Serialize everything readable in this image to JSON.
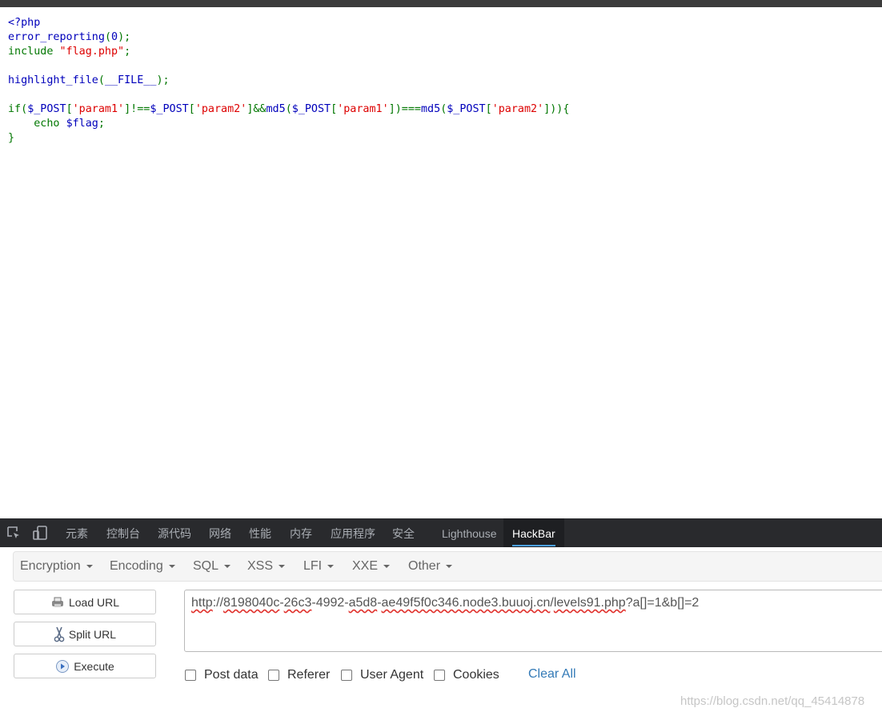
{
  "code": {
    "lines": [
      [
        {
          "t": "<?php",
          "c": "def"
        }
      ],
      [
        {
          "t": "error_reporting",
          "c": "def"
        },
        {
          "t": "(",
          "c": "kw"
        },
        {
          "t": "0",
          "c": "def"
        },
        {
          "t": ");",
          "c": "kw"
        }
      ],
      [
        {
          "t": "include ",
          "c": "kw"
        },
        {
          "t": "\"flag.php\"",
          "c": "str"
        },
        {
          "t": ";",
          "c": "kw"
        }
      ],
      [],
      [
        {
          "t": "highlight_file",
          "c": "def"
        },
        {
          "t": "(",
          "c": "kw"
        },
        {
          "t": "__FILE__",
          "c": "def"
        },
        {
          "t": ");",
          "c": "kw"
        }
      ],
      [],
      [
        {
          "t": "if(",
          "c": "kw"
        },
        {
          "t": "$_POST",
          "c": "def"
        },
        {
          "t": "[",
          "c": "kw"
        },
        {
          "t": "'param1'",
          "c": "str"
        },
        {
          "t": "]!==",
          "c": "kw"
        },
        {
          "t": "$_POST",
          "c": "def"
        },
        {
          "t": "[",
          "c": "kw"
        },
        {
          "t": "'param2'",
          "c": "str"
        },
        {
          "t": "]&&",
          "c": "kw"
        },
        {
          "t": "md5",
          "c": "def"
        },
        {
          "t": "(",
          "c": "kw"
        },
        {
          "t": "$_POST",
          "c": "def"
        },
        {
          "t": "[",
          "c": "kw"
        },
        {
          "t": "'param1'",
          "c": "str"
        },
        {
          "t": "])===",
          "c": "kw"
        },
        {
          "t": "md5",
          "c": "def"
        },
        {
          "t": "(",
          "c": "kw"
        },
        {
          "t": "$_POST",
          "c": "def"
        },
        {
          "t": "[",
          "c": "kw"
        },
        {
          "t": "'param2'",
          "c": "str"
        },
        {
          "t": "])){",
          "c": "kw"
        }
      ],
      [
        {
          "t": "    echo ",
          "c": "kw"
        },
        {
          "t": "$flag",
          "c": "def"
        },
        {
          "t": ";",
          "c": "kw"
        }
      ],
      [
        {
          "t": "}",
          "c": "kw"
        }
      ]
    ]
  },
  "devtools": {
    "tabs": [
      "元素",
      "控制台",
      "源代码",
      "网络",
      "性能",
      "内存",
      "应用程序",
      "安全",
      "Lighthouse"
    ],
    "active_tab": "HackBar",
    "icons": [
      "inspect-element-icon",
      "device-toolbar-icon"
    ]
  },
  "hackbar": {
    "menus": [
      "Encryption",
      "Encoding",
      "SQL",
      "XSS",
      "LFI",
      "XXE",
      "Other"
    ],
    "buttons": {
      "load": {
        "label": "Load URL",
        "icon": "load-url-icon"
      },
      "split": {
        "label": "Split URL",
        "icon": "scissors-icon"
      },
      "execute": {
        "label": "Execute",
        "icon": "play-icon"
      }
    },
    "url_parts": [
      {
        "t": "http",
        "sp": true
      },
      {
        "t": "://",
        "sp": false
      },
      {
        "t": "8198040c",
        "sp": true
      },
      {
        "t": "-",
        "sp": false
      },
      {
        "t": "26c3",
        "sp": true
      },
      {
        "t": "-4992-",
        "sp": false
      },
      {
        "t": "a5d8",
        "sp": true
      },
      {
        "t": "-",
        "sp": false
      },
      {
        "t": "ae49f5f0c346.node3.buuoj.cn",
        "sp": true
      },
      {
        "t": "/",
        "sp": false
      },
      {
        "t": "levels91.php",
        "sp": true
      },
      {
        "t": "?a[]=1&b[]=2",
        "sp": false
      }
    ],
    "options": [
      "Post data",
      "Referer",
      "User Agent",
      "Cookies"
    ],
    "clear_all": "Clear All"
  },
  "watermark": "https://blog.csdn.net/qq_45414878",
  "colors": {
    "code_default": "#0000bb",
    "code_keyword": "#007700",
    "code_string": "#dd0000",
    "devtools_bg": "#292a2d",
    "hackbar_accent": "#4a9fe6",
    "link": "#337ab7"
  }
}
